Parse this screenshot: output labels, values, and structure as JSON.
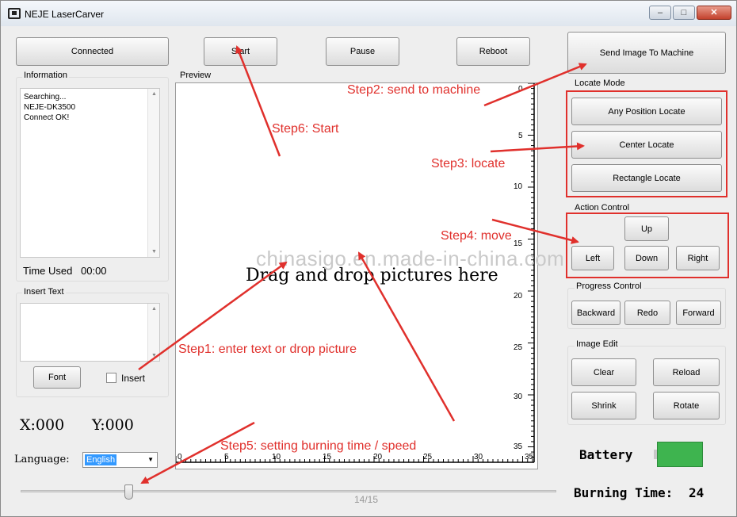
{
  "window": {
    "title": "NEJE LaserCarver",
    "minimize": "–",
    "maximize": "□",
    "close": "✕"
  },
  "toolbar": {
    "connected": "Connected",
    "start": "Start",
    "pause": "Pause",
    "reboot": "Reboot",
    "send_image": "Send Image To Machine"
  },
  "information": {
    "label": "Information",
    "lines": [
      "Searching...",
      "NEJE-DK3500",
      "Connect OK!"
    ],
    "time_used_label": "Time Used",
    "time_used_value": "00:00"
  },
  "insert_text": {
    "label": "Insert Text",
    "font_button": "Font",
    "insert_label": "Insert"
  },
  "coords": {
    "x": "X:000",
    "y": "Y:000"
  },
  "language": {
    "label": "Language:",
    "value": "English"
  },
  "preview": {
    "label": "Preview",
    "placeholder": "Drag and drop pictures here",
    "x_ticks": [
      "0",
      "5",
      "10",
      "15",
      "20",
      "25",
      "30",
      "35"
    ],
    "y_ticks": [
      "0",
      "5",
      "10",
      "15",
      "20",
      "25",
      "30",
      "35"
    ]
  },
  "locate_mode": {
    "label": "Locate Mode",
    "any_position": "Any Position Locate",
    "center": "Center Locate",
    "rectangle": "Rectangle Locate"
  },
  "action_control": {
    "label": "Action Control",
    "up": "Up",
    "left": "Left",
    "down": "Down",
    "right": "Right"
  },
  "progress_control": {
    "label": "Progress Control",
    "backward": "Backward",
    "redo": "Redo",
    "forward": "Forward"
  },
  "image_edit": {
    "label": "Image Edit",
    "clear": "Clear",
    "reload": "Reload",
    "shrink": "Shrink",
    "rotate": "Rotate"
  },
  "battery": {
    "label": "Battery",
    "color": "#3eb44f"
  },
  "burning_time": {
    "label": "Burning Time:",
    "value": "24"
  },
  "slider": {
    "value": 14,
    "max": 15,
    "readout": "14/15"
  },
  "annotations": {
    "step1": "Step1: enter text or drop picture",
    "step2": "Step2: send to machine",
    "step3": "Step3: locate",
    "step4": "Step4: move",
    "step5": "Step5: setting burning time / speed",
    "step6": "Step6: Start",
    "color": "#e0302c"
  },
  "watermark": "chinasigo.en.made-in-china.com"
}
